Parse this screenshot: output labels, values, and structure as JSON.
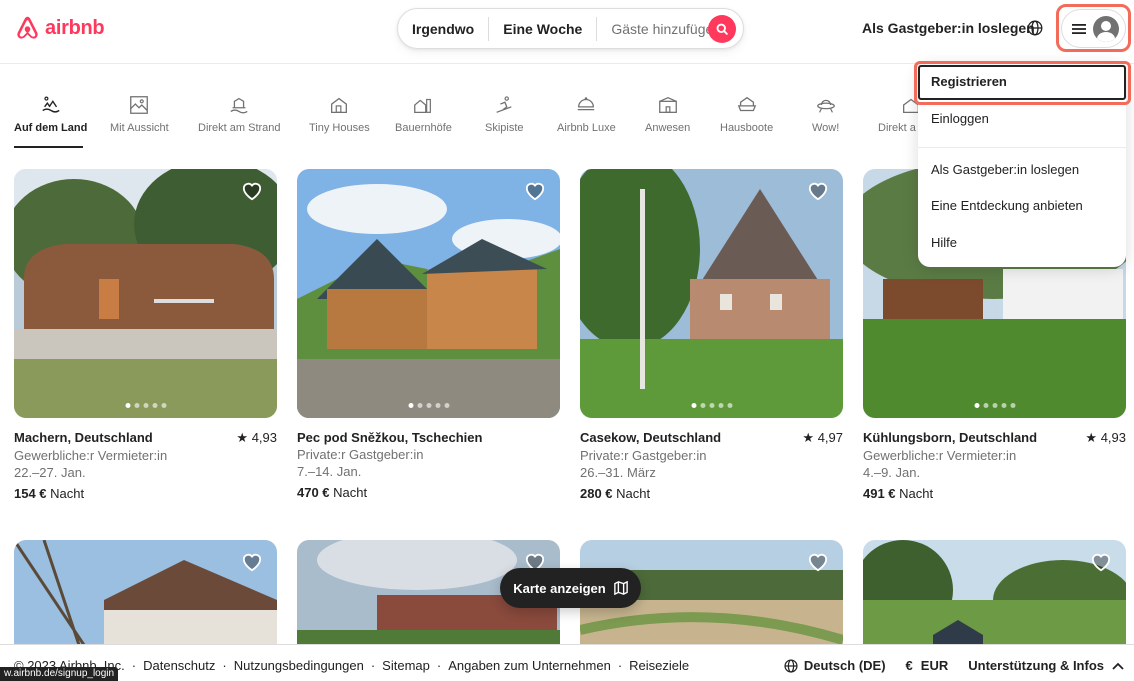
{
  "header": {
    "logo_text": "airbnb",
    "search": {
      "where": "Irgendwo",
      "when": "Eine Woche",
      "guests": "Gäste hinzufügen"
    },
    "host_link": "Als Gastgeber:in loslegen",
    "icons": [
      "globe-icon",
      "hamburger-icon",
      "avatar-icon",
      "search-icon"
    ],
    "brand_color": "#ff385c",
    "highlight_color": "#f26b5b"
  },
  "categories": [
    {
      "label": "Auf dem Land",
      "active": true
    },
    {
      "label": "Mit Aussicht"
    },
    {
      "label": "Direkt am Strand"
    },
    {
      "label": "Tiny Houses"
    },
    {
      "label": "Bauernhöfe"
    },
    {
      "label": "Skipiste"
    },
    {
      "label": "Airbnb Luxe"
    },
    {
      "label": "Anwesen"
    },
    {
      "label": "Hausboote"
    },
    {
      "label": "Wow!"
    },
    {
      "label": "Direkt a"
    }
  ],
  "listings": [
    {
      "title": "Machern, Deutschland",
      "rating": "★ 4,93",
      "host": "Gewerbliche:r Vermieter:in",
      "dates": "22.–27. Jan.",
      "price": "154 €",
      "unit": "Nacht"
    },
    {
      "title": "Pec pod Sněžkou, Tschechien",
      "rating": "",
      "host": "Private:r Gastgeber:in",
      "dates": "7.–14. Jan.",
      "price": "470 €",
      "unit": "Nacht"
    },
    {
      "title": "Casekow, Deutschland",
      "rating": "★ 4,97",
      "host": "Private:r Gastgeber:in",
      "dates": "26.–31. März",
      "price": "280 €",
      "unit": "Nacht"
    },
    {
      "title": "Kühlungsborn, Deutschland",
      "rating": "★ 4,93",
      "host": "Gewerbliche:r Vermieter:in",
      "dates": "4.–9. Jan.",
      "price": "491 €",
      "unit": "Nacht"
    }
  ],
  "dropdown": {
    "items": [
      "Registrieren",
      "Einloggen",
      "Als Gastgeber:in loslegen",
      "Eine Entdeckung anbieten",
      "Hilfe"
    ]
  },
  "map_button": "Karte anzeigen",
  "footer": {
    "left": [
      "© 2023 Airbnb, Inc.",
      "·",
      "Datenschutz",
      "·",
      "Nutzungsbedingungen",
      "·",
      "Sitemap",
      "·",
      "Angaben zum Unternehmen",
      "·",
      "Reiseziele"
    ],
    "language": "Deutsch (DE)",
    "currency_symbol": "€",
    "currency": "EUR",
    "support": "Unterstützung & Infos"
  },
  "status_url": "w.airbnb.de/signup_login"
}
